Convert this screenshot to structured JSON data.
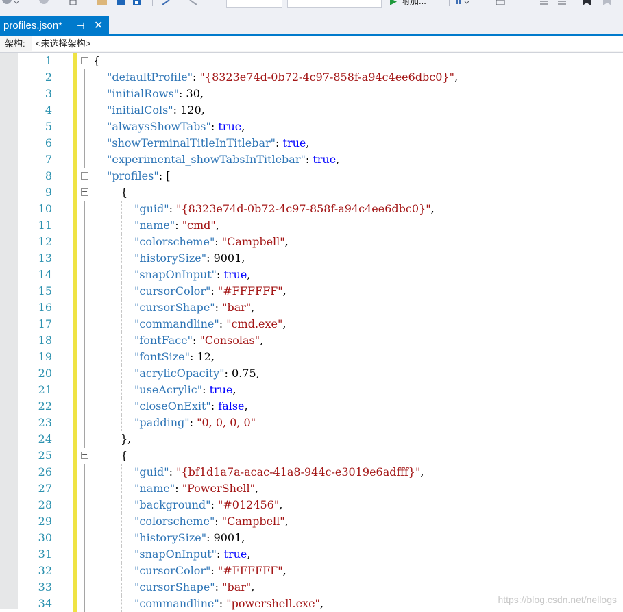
{
  "colors": {
    "accent": "#007acc",
    "line_number": "#2b91af",
    "property": "#2e75b6",
    "string": "#a31515",
    "boolean": "#0000ff",
    "change_marker": "#efe344"
  },
  "toolbar": {
    "run_label": "附加...",
    "icons": [
      "back-icon",
      "forward-icon",
      "new-file-icon",
      "open-folder-icon",
      "save-icon",
      "save-all-icon",
      "undo-icon",
      "redo-icon",
      "run-icon",
      "find-icon",
      "settings-icon",
      "bookmark-icon"
    ]
  },
  "tab": {
    "title": "profiles.json*",
    "pin_glyph": "⊣",
    "close_glyph": "✕"
  },
  "arch_bar": {
    "label": "架构:",
    "value": "<未选择架构>"
  },
  "editor": {
    "lines": [
      {
        "num": "1",
        "indent": 0,
        "fold": "box",
        "tokens": [
          {
            "t": "p",
            "v": "{"
          }
        ]
      },
      {
        "num": "2",
        "indent": 1,
        "fold": "line",
        "tokens": [
          {
            "t": "k",
            "v": "\"defaultProfile\""
          },
          {
            "t": "p",
            "v": ": "
          },
          {
            "t": "s",
            "v": "\"{8323e74d-0b72-4c97-858f-a94c4ee6dbc0}\""
          },
          {
            "t": "p",
            "v": ","
          }
        ]
      },
      {
        "num": "3",
        "indent": 1,
        "fold": "line",
        "tokens": [
          {
            "t": "k",
            "v": "\"initialRows\""
          },
          {
            "t": "p",
            "v": ": "
          },
          {
            "t": "n",
            "v": "30"
          },
          {
            "t": "p",
            "v": ","
          }
        ]
      },
      {
        "num": "4",
        "indent": 1,
        "fold": "line",
        "tokens": [
          {
            "t": "k",
            "v": "\"initialCols\""
          },
          {
            "t": "p",
            "v": ": "
          },
          {
            "t": "n",
            "v": "120"
          },
          {
            "t": "p",
            "v": ","
          }
        ]
      },
      {
        "num": "5",
        "indent": 1,
        "fold": "line",
        "tokens": [
          {
            "t": "k",
            "v": "\"alwaysShowTabs\""
          },
          {
            "t": "p",
            "v": ": "
          },
          {
            "t": "b",
            "v": "true"
          },
          {
            "t": "p",
            "v": ","
          }
        ]
      },
      {
        "num": "6",
        "indent": 1,
        "fold": "line",
        "tokens": [
          {
            "t": "k",
            "v": "\"showTerminalTitleInTitlebar\""
          },
          {
            "t": "p",
            "v": ": "
          },
          {
            "t": "b",
            "v": "true"
          },
          {
            "t": "p",
            "v": ","
          }
        ]
      },
      {
        "num": "7",
        "indent": 1,
        "fold": "line",
        "tokens": [
          {
            "t": "k",
            "v": "\"experimental_showTabsInTitlebar\""
          },
          {
            "t": "p",
            "v": ": "
          },
          {
            "t": "b",
            "v": "true"
          },
          {
            "t": "p",
            "v": ","
          }
        ]
      },
      {
        "num": "8",
        "indent": 1,
        "fold": "box",
        "tokens": [
          {
            "t": "k",
            "v": "\"profiles\""
          },
          {
            "t": "p",
            "v": ": ["
          }
        ]
      },
      {
        "num": "9",
        "indent": 2,
        "fold": "box",
        "tokens": [
          {
            "t": "p",
            "v": "{"
          }
        ]
      },
      {
        "num": "10",
        "indent": 3,
        "fold": "line",
        "tokens": [
          {
            "t": "k",
            "v": "\"guid\""
          },
          {
            "t": "p",
            "v": ": "
          },
          {
            "t": "s",
            "v": "\"{8323e74d-0b72-4c97-858f-a94c4ee6dbc0}\""
          },
          {
            "t": "p",
            "v": ","
          }
        ]
      },
      {
        "num": "11",
        "indent": 3,
        "fold": "line",
        "tokens": [
          {
            "t": "k",
            "v": "\"name\""
          },
          {
            "t": "p",
            "v": ": "
          },
          {
            "t": "s",
            "v": "\"cmd\""
          },
          {
            "t": "p",
            "v": ","
          }
        ]
      },
      {
        "num": "12",
        "indent": 3,
        "fold": "line",
        "tokens": [
          {
            "t": "k",
            "v": "\"colorscheme\""
          },
          {
            "t": "p",
            "v": ": "
          },
          {
            "t": "s",
            "v": "\"Campbell\""
          },
          {
            "t": "p",
            "v": ","
          }
        ]
      },
      {
        "num": "13",
        "indent": 3,
        "fold": "line",
        "tokens": [
          {
            "t": "k",
            "v": "\"historySize\""
          },
          {
            "t": "p",
            "v": ": "
          },
          {
            "t": "n",
            "v": "9001"
          },
          {
            "t": "p",
            "v": ","
          }
        ]
      },
      {
        "num": "14",
        "indent": 3,
        "fold": "line",
        "tokens": [
          {
            "t": "k",
            "v": "\"snapOnInput\""
          },
          {
            "t": "p",
            "v": ": "
          },
          {
            "t": "b",
            "v": "true"
          },
          {
            "t": "p",
            "v": ","
          }
        ]
      },
      {
        "num": "15",
        "indent": 3,
        "fold": "line",
        "tokens": [
          {
            "t": "k",
            "v": "\"cursorColor\""
          },
          {
            "t": "p",
            "v": ": "
          },
          {
            "t": "s",
            "v": "\"#FFFFFF\""
          },
          {
            "t": "p",
            "v": ","
          }
        ]
      },
      {
        "num": "16",
        "indent": 3,
        "fold": "line",
        "tokens": [
          {
            "t": "k",
            "v": "\"cursorShape\""
          },
          {
            "t": "p",
            "v": ": "
          },
          {
            "t": "s",
            "v": "\"bar\""
          },
          {
            "t": "p",
            "v": ","
          }
        ]
      },
      {
        "num": "17",
        "indent": 3,
        "fold": "line",
        "tokens": [
          {
            "t": "k",
            "v": "\"commandline\""
          },
          {
            "t": "p",
            "v": ": "
          },
          {
            "t": "s",
            "v": "\"cmd.exe\""
          },
          {
            "t": "p",
            "v": ","
          }
        ]
      },
      {
        "num": "18",
        "indent": 3,
        "fold": "line",
        "tokens": [
          {
            "t": "k",
            "v": "\"fontFace\""
          },
          {
            "t": "p",
            "v": ": "
          },
          {
            "t": "s",
            "v": "\"Consolas\""
          },
          {
            "t": "p",
            "v": ","
          }
        ]
      },
      {
        "num": "19",
        "indent": 3,
        "fold": "line",
        "tokens": [
          {
            "t": "k",
            "v": "\"fontSize\""
          },
          {
            "t": "p",
            "v": ": "
          },
          {
            "t": "n",
            "v": "12"
          },
          {
            "t": "p",
            "v": ","
          }
        ]
      },
      {
        "num": "20",
        "indent": 3,
        "fold": "line",
        "tokens": [
          {
            "t": "k",
            "v": "\"acrylicOpacity\""
          },
          {
            "t": "p",
            "v": ": "
          },
          {
            "t": "n",
            "v": "0.75"
          },
          {
            "t": "p",
            "v": ","
          }
        ]
      },
      {
        "num": "21",
        "indent": 3,
        "fold": "line",
        "tokens": [
          {
            "t": "k",
            "v": "\"useAcrylic\""
          },
          {
            "t": "p",
            "v": ": "
          },
          {
            "t": "b",
            "v": "true"
          },
          {
            "t": "p",
            "v": ","
          }
        ]
      },
      {
        "num": "22",
        "indent": 3,
        "fold": "line",
        "tokens": [
          {
            "t": "k",
            "v": "\"closeOnExit\""
          },
          {
            "t": "p",
            "v": ": "
          },
          {
            "t": "b",
            "v": "false"
          },
          {
            "t": "p",
            "v": ","
          }
        ]
      },
      {
        "num": "23",
        "indent": 3,
        "fold": "line",
        "tokens": [
          {
            "t": "k",
            "v": "\"padding\""
          },
          {
            "t": "p",
            "v": ": "
          },
          {
            "t": "s",
            "v": "\"0, 0, 0, 0\""
          }
        ]
      },
      {
        "num": "24",
        "indent": 2,
        "fold": "line",
        "tokens": [
          {
            "t": "p",
            "v": "},"
          }
        ]
      },
      {
        "num": "25",
        "indent": 2,
        "fold": "box",
        "tokens": [
          {
            "t": "p",
            "v": "{"
          }
        ]
      },
      {
        "num": "26",
        "indent": 3,
        "fold": "line",
        "tokens": [
          {
            "t": "k",
            "v": "\"guid\""
          },
          {
            "t": "p",
            "v": ": "
          },
          {
            "t": "s",
            "v": "\"{bf1d1a7a-acac-41a8-944c-e3019e6adfff}\""
          },
          {
            "t": "p",
            "v": ","
          }
        ]
      },
      {
        "num": "27",
        "indent": 3,
        "fold": "line",
        "tokens": [
          {
            "t": "k",
            "v": "\"name\""
          },
          {
            "t": "p",
            "v": ": "
          },
          {
            "t": "s",
            "v": "\"PowerShell\""
          },
          {
            "t": "p",
            "v": ","
          }
        ]
      },
      {
        "num": "28",
        "indent": 3,
        "fold": "line",
        "tokens": [
          {
            "t": "k",
            "v": "\"background\""
          },
          {
            "t": "p",
            "v": ": "
          },
          {
            "t": "s",
            "v": "\"#012456\""
          },
          {
            "t": "p",
            "v": ","
          }
        ]
      },
      {
        "num": "29",
        "indent": 3,
        "fold": "line",
        "tokens": [
          {
            "t": "k",
            "v": "\"colorscheme\""
          },
          {
            "t": "p",
            "v": ": "
          },
          {
            "t": "s",
            "v": "\"Campbell\""
          },
          {
            "t": "p",
            "v": ","
          }
        ]
      },
      {
        "num": "30",
        "indent": 3,
        "fold": "line",
        "tokens": [
          {
            "t": "k",
            "v": "\"historySize\""
          },
          {
            "t": "p",
            "v": ": "
          },
          {
            "t": "n",
            "v": "9001"
          },
          {
            "t": "p",
            "v": ","
          }
        ]
      },
      {
        "num": "31",
        "indent": 3,
        "fold": "line",
        "tokens": [
          {
            "t": "k",
            "v": "\"snapOnInput\""
          },
          {
            "t": "p",
            "v": ": "
          },
          {
            "t": "b",
            "v": "true"
          },
          {
            "t": "p",
            "v": ","
          }
        ]
      },
      {
        "num": "32",
        "indent": 3,
        "fold": "line",
        "tokens": [
          {
            "t": "k",
            "v": "\"cursorColor\""
          },
          {
            "t": "p",
            "v": ": "
          },
          {
            "t": "s",
            "v": "\"#FFFFFF\""
          },
          {
            "t": "p",
            "v": ","
          }
        ]
      },
      {
        "num": "33",
        "indent": 3,
        "fold": "line",
        "tokens": [
          {
            "t": "k",
            "v": "\"cursorShape\""
          },
          {
            "t": "p",
            "v": ": "
          },
          {
            "t": "s",
            "v": "\"bar\""
          },
          {
            "t": "p",
            "v": ","
          }
        ]
      },
      {
        "num": "34",
        "indent": 3,
        "fold": "line",
        "tokens": [
          {
            "t": "k",
            "v": "\"commandline\""
          },
          {
            "t": "p",
            "v": ": "
          },
          {
            "t": "s",
            "v": "\"powershell.exe\""
          },
          {
            "t": "p",
            "v": ","
          }
        ]
      }
    ]
  },
  "watermark": "https://blog.csdn.net/nellogs"
}
